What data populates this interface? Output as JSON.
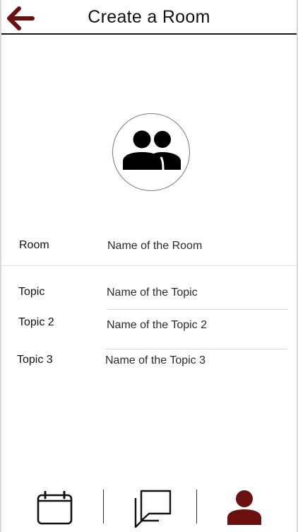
{
  "header": {
    "title": "Create a Room",
    "back_icon": "arrow-left-icon",
    "accent_color": "#6b0f0f"
  },
  "avatar": {
    "icon": "group-icon"
  },
  "form": {
    "room": {
      "label": "Room",
      "placeholder": "Name of the Room"
    },
    "topic1": {
      "label": "Topic",
      "placeholder": "Name of the Topic"
    },
    "topic2": {
      "label": "Topic 2",
      "placeholder": "Name of the Topic 2"
    },
    "topic3": {
      "label": "Topic 3",
      "placeholder": "Name of the Topic 3"
    }
  },
  "bottom_nav": {
    "items": [
      {
        "icon": "calendar-icon",
        "active": false
      },
      {
        "icon": "chat-icon",
        "active": false
      },
      {
        "icon": "profile-icon",
        "active": true
      }
    ],
    "active_color": "#6b0f0f"
  }
}
